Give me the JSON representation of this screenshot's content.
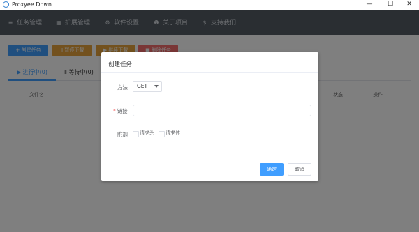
{
  "window": {
    "title": "Proxyee Down",
    "minimize": "—",
    "maximize": "☐",
    "close": "✕"
  },
  "nav": [
    {
      "icon": "list-icon",
      "glyph": "≡",
      "label": "任务管理"
    },
    {
      "icon": "puzzle-icon",
      "glyph": "▦",
      "label": "扩展管理"
    },
    {
      "icon": "gear-icon",
      "glyph": "⚙",
      "label": "软件设置"
    },
    {
      "icon": "info-icon",
      "glyph": "❶",
      "label": "关于项目"
    },
    {
      "icon": "dollar-icon",
      "glyph": "$",
      "label": "支持我们"
    }
  ],
  "toolbar": {
    "create": "+ 创建任务",
    "pause": "Ⅱ 暂停下载",
    "resume": "▶ 继续下载",
    "delete": "■ 删除任务"
  },
  "tabs": {
    "running": "进行中(0)",
    "waiting": "等待中(0)"
  },
  "table": {
    "headers": [
      "文件名",
      "状态",
      "操作"
    ]
  },
  "dialog": {
    "title": "创建任务",
    "method_label": "方法",
    "method_value": "GET",
    "link_required_mark": "*",
    "link_label": "链接",
    "link_value": "",
    "extra_label": "附加",
    "options": [
      "请求头",
      "请求体"
    ],
    "confirm": "确定",
    "cancel": "取消"
  },
  "colors": {
    "navbar": "#545c64",
    "primary": "#409eff",
    "warning": "#e6a23c",
    "danger": "#f56c6c"
  }
}
